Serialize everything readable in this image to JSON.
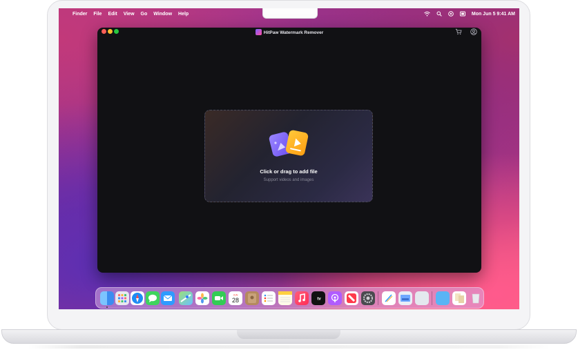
{
  "menubar": {
    "items": [
      "Finder",
      "File",
      "Edit",
      "View",
      "Go",
      "Window",
      "Help"
    ],
    "clock": "Mon Jun 5  9:41 AM"
  },
  "window": {
    "title": "HitPaw Watermark Remover"
  },
  "dropzone": {
    "title": "Click or drag to add file",
    "subtitle": "Support videos and images"
  },
  "dock": {
    "calendar_day": "28",
    "calendar_month": "JUN",
    "tv_label": "tv",
    "apps": [
      "finder",
      "launchpad",
      "safari",
      "messages",
      "mail",
      "maps",
      "photos",
      "facetime",
      "calendar",
      "contacts",
      "reminders",
      "notes",
      "music",
      "tv",
      "podcasts",
      "news",
      "app-store",
      "system-settings",
      "freeform",
      "preview",
      "screenshot",
      "downloads",
      "documents",
      "trash"
    ]
  },
  "colors": {
    "window_bg": "#111114",
    "accent_purple": "#7b5cff",
    "accent_yellow": "#ffb21e"
  }
}
